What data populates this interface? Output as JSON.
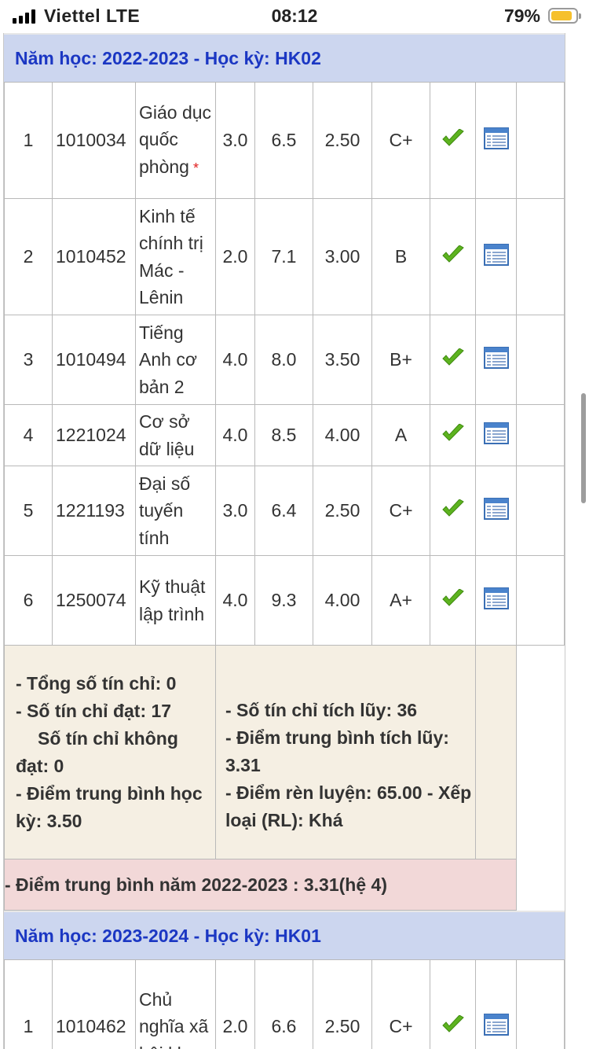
{
  "status_bar": {
    "carrier": "Viettel  LTE",
    "time": "08:12",
    "battery": "79%"
  },
  "semesters": [
    {
      "title": "Năm học: 2022-2023 - Học kỳ: HK02",
      "rows": [
        {
          "idx": "1",
          "code": "1010034",
          "name": "Giáo dục quốc phòng",
          "required": true,
          "credits": "3.0",
          "score": "6.5",
          "gpa": "2.50",
          "letter": "C+"
        },
        {
          "idx": "2",
          "code": "1010452",
          "name": "Kinh tế chính trị Mác - Lênin",
          "required": false,
          "credits": "2.0",
          "score": "7.1",
          "gpa": "3.00",
          "letter": "B"
        },
        {
          "idx": "3",
          "code": "1010494",
          "name": "Tiếng Anh cơ bản 2",
          "required": false,
          "credits": "4.0",
          "score": "8.0",
          "gpa": "3.50",
          "letter": "B+"
        },
        {
          "idx": "4",
          "code": "1221024",
          "name": "Cơ sở dữ liệu",
          "required": false,
          "credits": "4.0",
          "score": "8.5",
          "gpa": "4.00",
          "letter": "A"
        },
        {
          "idx": "5",
          "code": "1221193",
          "name": "Đại số tuyến tính",
          "required": false,
          "credits": "3.0",
          "score": "6.4",
          "gpa": "2.50",
          "letter": "C+"
        },
        {
          "idx": "6",
          "code": "1250074",
          "name": "Kỹ thuật lập trình",
          "required": false,
          "credits": "4.0",
          "score": "9.3",
          "gpa": "4.00",
          "letter": "A+"
        }
      ],
      "summary": {
        "total_credits": "- Tổng số tín chỉ: 0",
        "passed_credits": "- Số tín chỉ đạt: 17",
        "failed_credits": "Số tín chỉ không đạt: 0",
        "semester_gpa": "- Điểm trung bình học kỳ: 3.50",
        "accumulated_credits": "- Số tín chỉ tích lũy: 36",
        "accumulated_gpa": "- Điểm trung bình tích lũy: 3.31",
        "conduct": "- Điểm rèn luyện: 65.00 - Xếp loại (RL): Khá"
      },
      "year_gpa": "- Điểm trung bình năm 2022-2023 : 3.31(hệ 4)"
    },
    {
      "title": "Năm học: 2023-2024 - Học kỳ: HK01",
      "rows": [
        {
          "idx": "1",
          "code": "1010462",
          "name": "Chủ nghĩa xã hội khoa",
          "required": false,
          "credits": "2.0",
          "score": "6.6",
          "gpa": "2.50",
          "letter": "C+"
        }
      ]
    }
  ],
  "icons": {
    "passed": "check-icon",
    "detail": "detail-icon"
  },
  "colors": {
    "header_bg": "#ccd6ef",
    "header_text": "#1b37c3",
    "summary_bg": "#f5efe3",
    "year_bg": "#f2d8d8",
    "check": "#5db31f"
  }
}
